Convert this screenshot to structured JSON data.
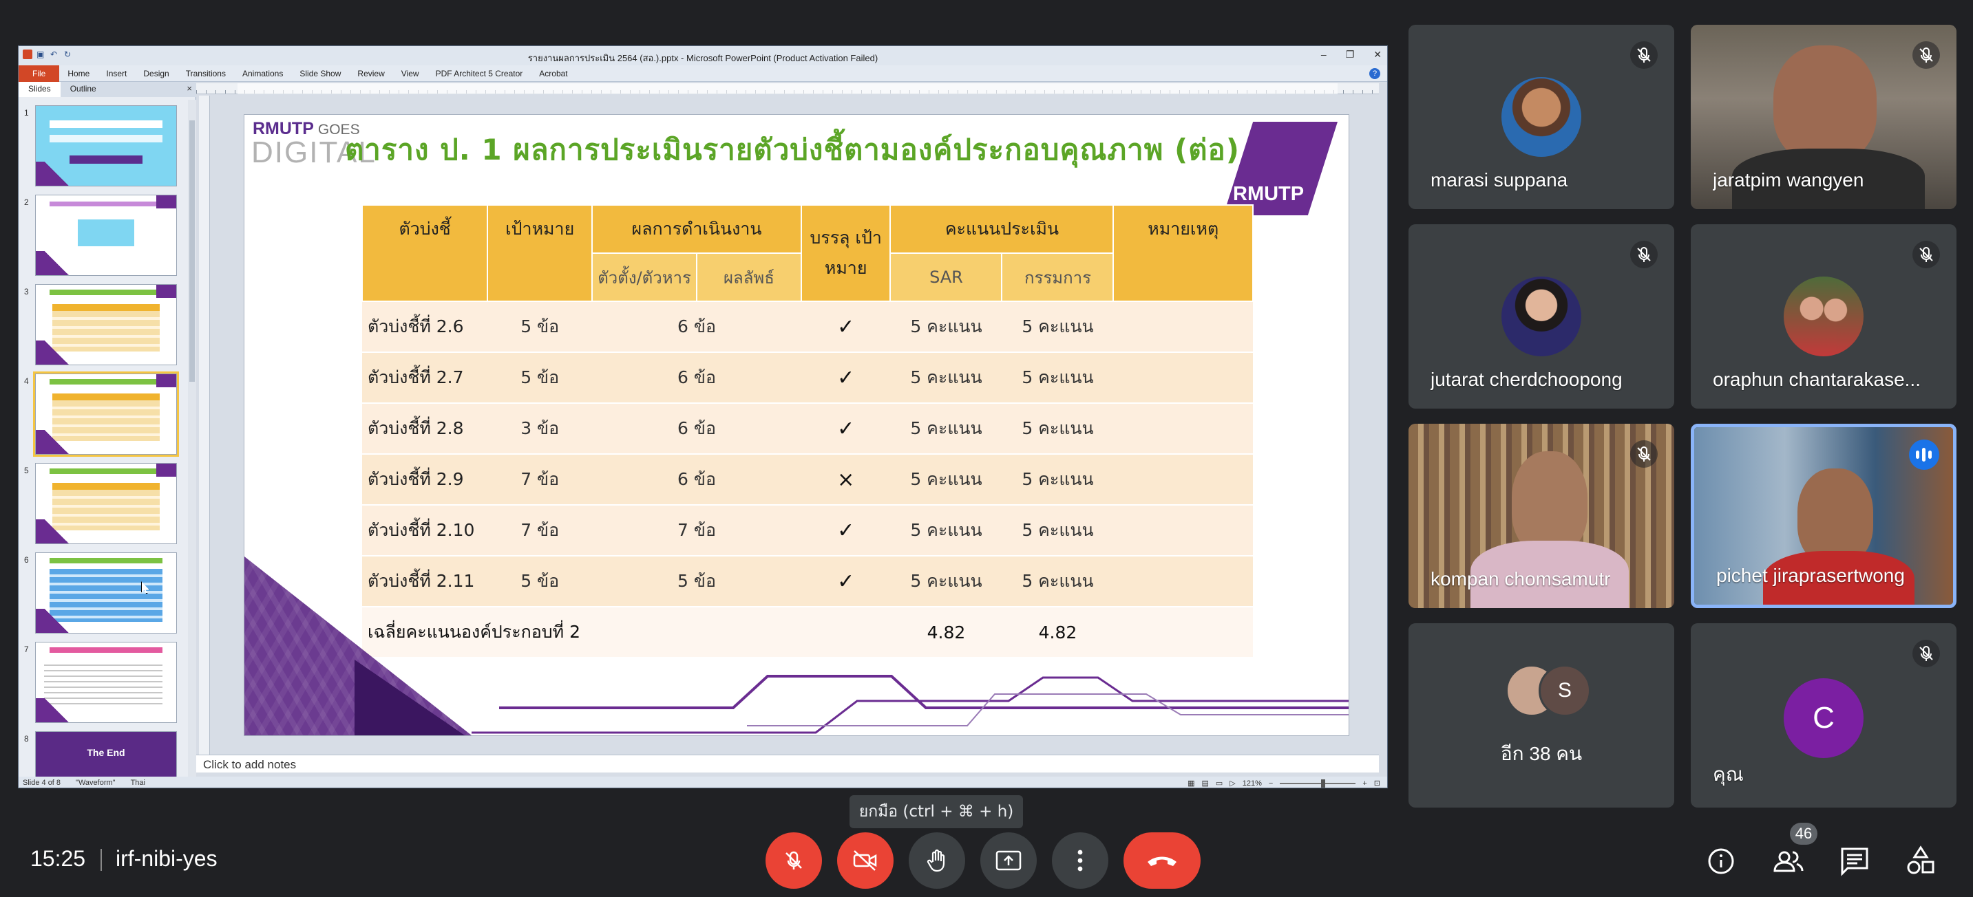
{
  "ppt": {
    "window_title": "รายงานผลการประเมิน 2564 (สอ.).pptx - Microsoft PowerPoint (Product Activation Failed)",
    "ribbon_tabs": [
      "File",
      "Home",
      "Insert",
      "Design",
      "Transitions",
      "Animations",
      "Slide Show",
      "Review",
      "View",
      "PDF Architect 5 Creator",
      "Acrobat"
    ],
    "panel_tabs": [
      "Slides",
      "Outline"
    ],
    "thumbnail_numbers": [
      "1",
      "2",
      "3",
      "4",
      "5",
      "6",
      "7",
      "8"
    ],
    "thumbnail_8_text": "The End",
    "notes_placeholder": "Click to add notes",
    "status": {
      "slide": "Slide 4 of 8",
      "theme": "\"Waveform\"",
      "language": "Thai",
      "zoom": "121%"
    }
  },
  "slide": {
    "logo_top": "RMUTP",
    "logo_goes": "GOES",
    "logo_bottom": "DIGITAL",
    "title": "ตาราง ป. 1 ผลการประเมินรายตัวบ่งชี้ตามองค์ประกอบคุณภาพ (ต่อ)",
    "brand": "RMUTP",
    "headers": {
      "indicator": "ตัวบ่งชี้",
      "target": "เป้าหมาย",
      "performance": "ผลการดำเนินงาน",
      "achieved": "บรรลุ เป้าหมาย",
      "score": "คะแนนประเมิน",
      "remark": "หมายเหตุ",
      "perf_sub1": "ตัวตั้ง/ตัวหาร",
      "perf_sub2": "ผลลัพธ์",
      "score_sub1": "SAR",
      "score_sub2": "กรรมการ"
    },
    "rows": [
      {
        "indicator": "ตัวบ่งชี้ที่ 2.6",
        "target": "5 ข้อ",
        "result": "6 ข้อ",
        "achieved": "✓",
        "sar": "5 คะแนน",
        "committee": "5 คะแนน"
      },
      {
        "indicator": "ตัวบ่งชี้ที่ 2.7",
        "target": "5 ข้อ",
        "result": "6 ข้อ",
        "achieved": "✓",
        "sar": "5 คะแนน",
        "committee": "5 คะแนน"
      },
      {
        "indicator": "ตัวบ่งชี้ที่ 2.8",
        "target": "3 ข้อ",
        "result": "6 ข้อ",
        "achieved": "✓",
        "sar": "5 คะแนน",
        "committee": "5 คะแนน"
      },
      {
        "indicator": "ตัวบ่งชี้ที่ 2.9",
        "target": "7 ข้อ",
        "result": "6 ข้อ",
        "achieved": "×",
        "sar": "5 คะแนน",
        "committee": "5 คะแนน"
      },
      {
        "indicator": "ตัวบ่งชี้ที่ 2.10",
        "target": "7 ข้อ",
        "result": "7 ข้อ",
        "achieved": "✓",
        "sar": "5 คะแนน",
        "committee": "5 คะแนน"
      },
      {
        "indicator": "ตัวบ่งชี้ที่ 2.11",
        "target": "5 ข้อ",
        "result": "5 ข้อ",
        "achieved": "✓",
        "sar": "5 คะแนน",
        "committee": "5 คะแนน"
      }
    ],
    "average": {
      "label": "เฉลี่ยคะแนนองค์ประกอบที่ 2",
      "sar": "4.82",
      "committee": "4.82"
    }
  },
  "participants": [
    {
      "name": "marasi suppana",
      "muted": true
    },
    {
      "name": "jaratpim wangyen",
      "muted": true
    },
    {
      "name": "jutarat cherdchoopong",
      "muted": true
    },
    {
      "name": "oraphun chantarakase...",
      "muted": true
    },
    {
      "name": "kompan chomsamutr",
      "muted": true
    },
    {
      "name": "pichet jiraprasertwong",
      "speaking": true
    },
    {
      "more_label": "อีก 38 คน",
      "initial": "S"
    },
    {
      "name": "คุณ",
      "initial": "C",
      "muted": true
    }
  ],
  "bottom": {
    "time": "15:25",
    "meeting_code": "irf-nibi-yes",
    "tooltip": "ยกมือ (ctrl + ⌘ + h)",
    "people_count": "46"
  },
  "colors": {
    "accent_purple": "#6a2c91",
    "header_gold": "#f2ba3e",
    "title_green": "#5ba526",
    "end_red": "#ea4335",
    "speaking_blue": "#8ab4f8"
  }
}
